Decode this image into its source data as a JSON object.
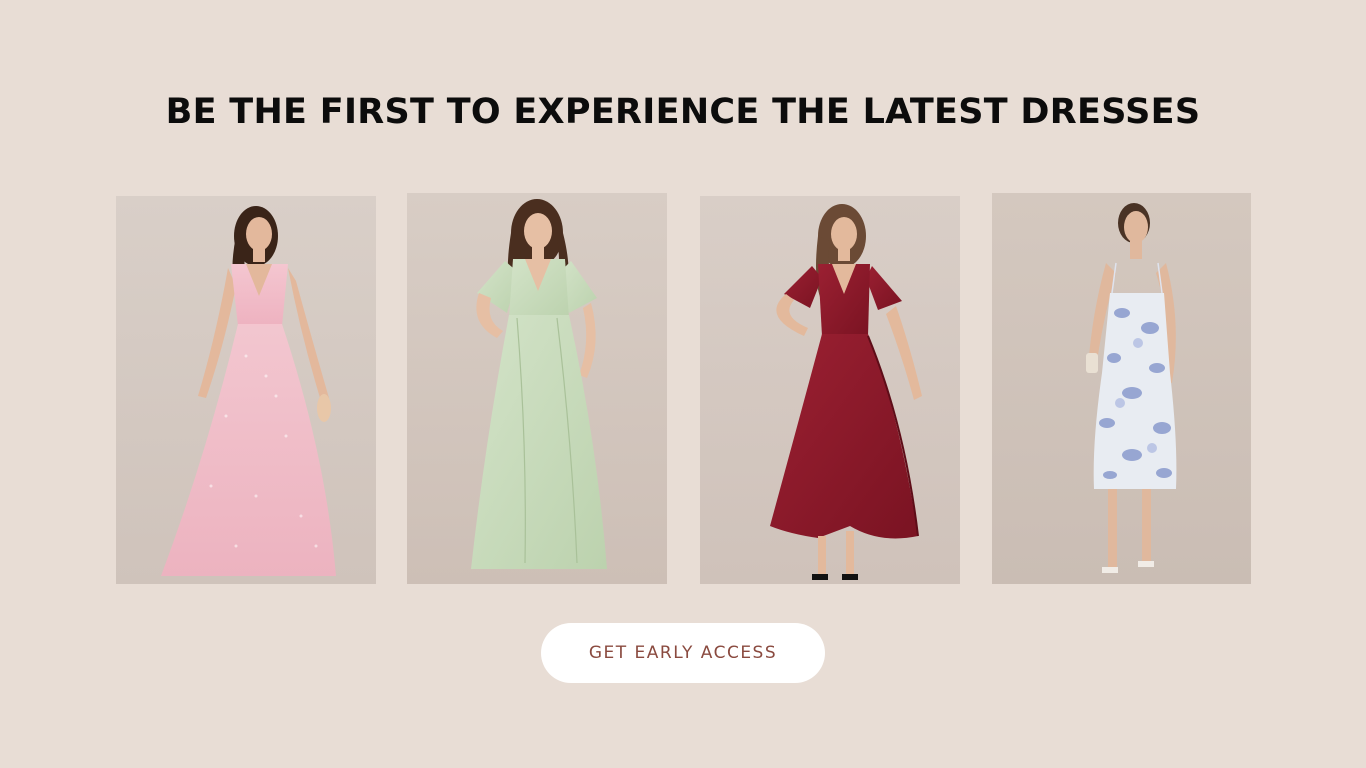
{
  "headline": "BE THE FIRST TO EXPERIENCE THE LATEST DRESSES",
  "cta": {
    "label": "GET EARLY ACCESS"
  },
  "colors": {
    "background": "#e8ddd5",
    "headline": "#0c0c0c",
    "button_bg": "#ffffff",
    "button_text": "#8a4a3f"
  },
  "products": [
    {
      "image": "pink-sequin-tulle-gown-photo",
      "dress_color": "#f2b9c6"
    },
    {
      "image": "sage-green-flutter-sleeve-maxi-photo",
      "dress_color": "#c9dcbf"
    },
    {
      "image": "burgundy-satin-ruffle-wrap-dress-photo",
      "dress_color": "#8e1a2a"
    },
    {
      "image": "blue-floral-print-midi-slip-dress-photo",
      "dress_color": "#c9d3ea"
    }
  ]
}
